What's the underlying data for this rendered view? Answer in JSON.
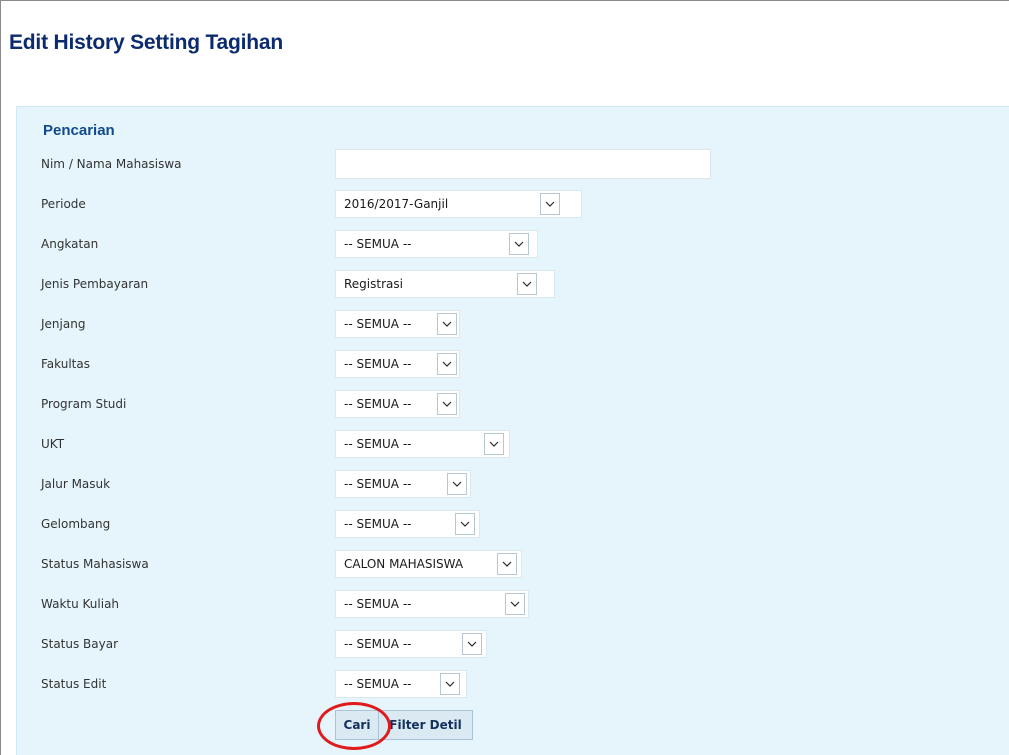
{
  "page": {
    "title": "Edit History Setting Tagihan"
  },
  "search": {
    "title": "Pencarian",
    "fields": [
      {
        "label": "Nim / Nama Mahasiswa",
        "value": ""
      },
      {
        "label": "Periode",
        "value": "2016/2017-Ganjil"
      },
      {
        "label": "Angkatan",
        "value": "-- SEMUA --"
      },
      {
        "label": "Jenis Pembayaran",
        "value": "Registrasi"
      },
      {
        "label": "Jenjang",
        "value": "-- SEMUA --"
      },
      {
        "label": "Fakultas",
        "value": "-- SEMUA --"
      },
      {
        "label": "Program Studi",
        "value": "-- SEMUA --"
      },
      {
        "label": "UKT",
        "value": "-- SEMUA --"
      },
      {
        "label": "Jalur Masuk",
        "value": "-- SEMUA --"
      },
      {
        "label": "Gelombang",
        "value": "-- SEMUA --"
      },
      {
        "label": "Status Mahasiswa",
        "value": "CALON MAHASISWA"
      },
      {
        "label": "Waktu Kuliah",
        "value": "-- SEMUA --"
      },
      {
        "label": "Status Bayar",
        "value": "-- SEMUA --"
      },
      {
        "label": "Status Edit",
        "value": "-- SEMUA --"
      }
    ],
    "buttons": {
      "cari": "Cari",
      "filter_detil": "Filter Detil"
    }
  },
  "colors": {
    "title": "#0c2a6e",
    "panel_bg": "#e6f5fc",
    "highlight": "#e01b1b"
  },
  "icons": {
    "dropdown": "chevron-down-icon"
  }
}
